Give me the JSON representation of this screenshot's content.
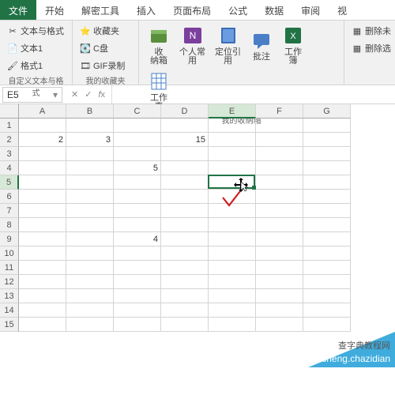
{
  "tabs": {
    "file": "文件",
    "home": "开始",
    "tools": "解密工具",
    "insert": "插入",
    "layout": "页面布局",
    "formulas": "公式",
    "data": "数据",
    "review": "审阅",
    "view": "视"
  },
  "ribbon": {
    "g1": {
      "textfmt": "文本与格式",
      "txt1": "文本1",
      "fmt1": "格式1",
      "label": "自定义文本与格式"
    },
    "g2": {
      "fav": "收藏夹",
      "cdrive": "C盘",
      "gif": "GIF录制",
      "label": "我的收藏夹"
    },
    "g3": {
      "storage": "收\n纳箱",
      "personal": "个人常\n用",
      "locate": "定位引\n用",
      "annotate": "批注",
      "workbook": "工作\n簿",
      "worksheet": "工作\n表",
      "label": "我的收纳箱"
    },
    "g4": {
      "delrow": "删除未",
      "delsel": "删除选"
    }
  },
  "namebox": {
    "ref": "E5"
  },
  "columns": [
    "A",
    "B",
    "C",
    "D",
    "E",
    "F",
    "G"
  ],
  "rows": [
    "1",
    "2",
    "3",
    "4",
    "5",
    "6",
    "7",
    "8",
    "9",
    "10",
    "11",
    "12",
    "13",
    "14",
    "15"
  ],
  "cells": {
    "A2": "2",
    "B2": "3",
    "D2": "15",
    "C4": "5",
    "C9": "4"
  },
  "active": {
    "col": "E",
    "row": "5"
  },
  "watermark": {
    "line1": "查字典教程网",
    "line2": "jiaocheng.chazidian"
  },
  "chart_data": null
}
